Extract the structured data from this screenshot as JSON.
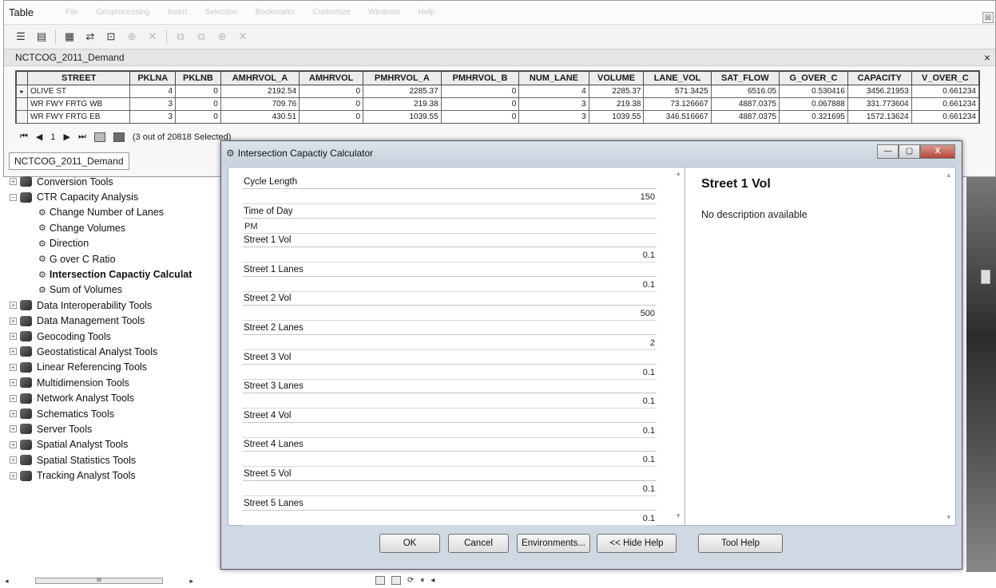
{
  "table_window": {
    "title": "Table",
    "menu": [
      "Table",
      "File",
      "Geoprocessing",
      "Insert",
      "Selection",
      "Bookmarks",
      "Customize",
      "Windows",
      "Help"
    ],
    "close_glyph": "☒",
    "layer_name": "NCTCOG_2011_Demand",
    "close_tab_glyph": "×",
    "columns": [
      "STREET",
      "PKLNA",
      "PKLNB",
      "AMHRVOL_A",
      "AMHRVOL",
      "PMHRVOL_A",
      "PMHRVOL_B",
      "NUM_LANE",
      "VOLUME",
      "LANE_VOL",
      "SAT_FLOW",
      "G_OVER_C",
      "CAPACITY",
      "V_OVER_C"
    ],
    "rows": [
      {
        "marker": "▸",
        "cells": [
          "OLIVE ST",
          "4",
          "0",
          "2192.54",
          "0",
          "2285.37",
          "0",
          "4",
          "2285.37",
          "571.3425",
          "6516.05",
          "0.530416",
          "3456.21953",
          "0.661234"
        ]
      },
      {
        "marker": "",
        "cells": [
          "WR FWY FRTG WB",
          "3",
          "0",
          "709.76",
          "0",
          "219.38",
          "0",
          "3",
          "219.38",
          "73.126667",
          "4887.0375",
          "0.067888",
          "331.773604",
          "0.661234"
        ]
      },
      {
        "marker": "",
        "cells": [
          "WR FWY FRTG EB",
          "3",
          "0",
          "430.51",
          "0",
          "1039.55",
          "0",
          "3",
          "1039.55",
          "346.516667",
          "4887.0375",
          "0.321695",
          "1572.13624",
          "0.661234"
        ]
      }
    ],
    "nav": {
      "first": "⏮",
      "prev": "◀",
      "record": "1",
      "next": "▶",
      "last": "⏭",
      "selection_text": "(3 out of 20818 Selected)"
    },
    "bottom_tab": "NCTCOG_2011_Demand"
  },
  "toolbox": {
    "items": [
      {
        "type": "root",
        "expander": "+",
        "label": "Conversion Tools"
      },
      {
        "type": "root",
        "expander": "−",
        "label": "CTR Capacity Analysis"
      },
      {
        "type": "child",
        "label": "Change Number of Lanes"
      },
      {
        "type": "child",
        "label": "Change Volumes"
      },
      {
        "type": "child",
        "label": "Direction"
      },
      {
        "type": "child",
        "label": "G over C Ratio"
      },
      {
        "type": "child",
        "label": "Intersection Capactiy Calculat",
        "bold": true
      },
      {
        "type": "child",
        "label": "Sum of Volumes"
      },
      {
        "type": "root",
        "expander": "+",
        "label": "Data Interoperability Tools"
      },
      {
        "type": "root",
        "expander": "+",
        "label": "Data Management Tools"
      },
      {
        "type": "root",
        "expander": "+",
        "label": "Geocoding Tools"
      },
      {
        "type": "root",
        "expander": "+",
        "label": "Geostatistical Analyst Tools"
      },
      {
        "type": "root",
        "expander": "+",
        "label": "Linear Referencing Tools"
      },
      {
        "type": "root",
        "expander": "+",
        "label": "Multidimension Tools"
      },
      {
        "type": "root",
        "expander": "+",
        "label": "Network Analyst Tools"
      },
      {
        "type": "root",
        "expander": "+",
        "label": "Schematics Tools"
      },
      {
        "type": "root",
        "expander": "+",
        "label": "Server Tools"
      },
      {
        "type": "root",
        "expander": "+",
        "label": "Spatial Analyst Tools"
      },
      {
        "type": "root",
        "expander": "+",
        "label": "Spatial Statistics Tools"
      },
      {
        "type": "root",
        "expander": "+",
        "label": "Tracking Analyst Tools"
      }
    ],
    "scroll_thumb_text": "III"
  },
  "dialog": {
    "title": "Intersection Capactiy Calculator",
    "win_controls": {
      "minimize": "—",
      "maximize": "▢",
      "close": "X"
    },
    "params": [
      {
        "label": "Cycle Length",
        "value": "150"
      },
      {
        "label": "Time of Day",
        "value": "PM",
        "align_left": true
      },
      {
        "label": "Street 1 Vol",
        "value": "0.1"
      },
      {
        "label": "Street 1 Lanes",
        "value": "0.1"
      },
      {
        "label": "Street 2 Vol",
        "value": "500"
      },
      {
        "label": "Street 2 Lanes",
        "value": "2"
      },
      {
        "label": "Street 3 Vol",
        "value": "0.1"
      },
      {
        "label": "Street 3 Lanes",
        "value": "0.1"
      },
      {
        "label": "Street 4 Vol",
        "value": "0.1"
      },
      {
        "label": "Street 4 Lanes",
        "value": "0.1"
      },
      {
        "label": "Street 5 Vol",
        "value": "0.1"
      },
      {
        "label": "Street 5 Lanes",
        "value": "0.1"
      }
    ],
    "help": {
      "title": "Street 1 Vol",
      "description": "No description available"
    },
    "buttons": {
      "ok": "OK",
      "cancel": "Cancel",
      "environments": "Environments...",
      "hide_help": "<< Hide Help",
      "tool_help": "Tool Help"
    }
  },
  "colors": {
    "dialog_frame": "#cfd8e3",
    "table_header": "#ececec"
  }
}
